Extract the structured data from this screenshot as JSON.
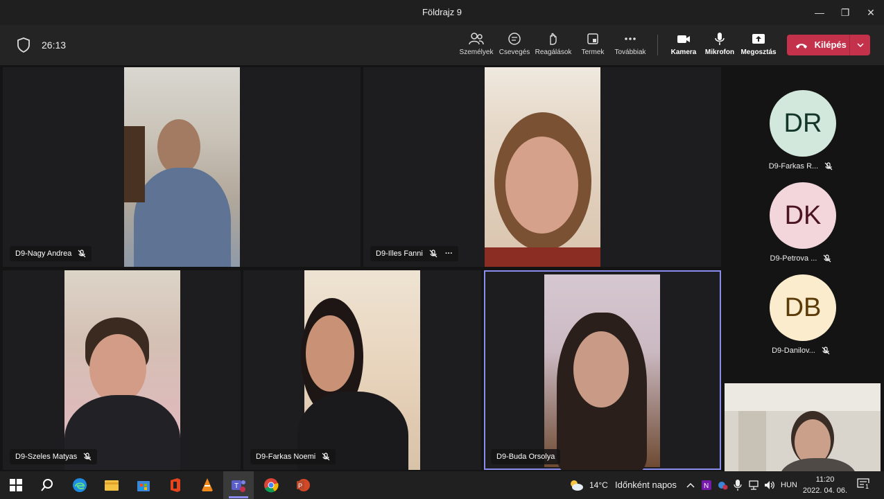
{
  "window": {
    "title": "Földrajz 9",
    "min": "—",
    "max": "❐",
    "close": "✕"
  },
  "toolbar": {
    "timer": "26:13",
    "people": "Személyek",
    "chat": "Csevegés",
    "reactions": "Reagálások",
    "rooms": "Termek",
    "more": "Továbbiak",
    "camera": "Kamera",
    "mic": "Mikrofon",
    "share": "Megosztás",
    "leave": "Kilépés"
  },
  "tiles": [
    {
      "name": "D9-Nagy Andrea"
    },
    {
      "name": "D9-Illes Fanni",
      "more": "···"
    },
    {
      "name": "D9-Szeles Matyas"
    },
    {
      "name": "D9-Farkas Noemi"
    },
    {
      "name": "D9-Buda Orsolya"
    }
  ],
  "side": [
    {
      "initials": "DR",
      "name": "D9-Farkas R...",
      "color": "#d3e8dc",
      "text": "#14352a"
    },
    {
      "initials": "DK",
      "name": "D9-Petrova ...",
      "color": "#f2d6dc",
      "text": "#4a1420"
    },
    {
      "initials": "DB",
      "name": "D9-Danilov...",
      "color": "#fbeccd",
      "text": "#5b3b08"
    }
  ],
  "taskbar": {
    "weather_temp": "14°C",
    "weather_text": "Időnként napos",
    "lang": "HUN",
    "time": "11:20",
    "date": "2022. 04. 06.",
    "notif": "1"
  },
  "colors": {
    "accent": "#8b8cf0",
    "leave": "#c4314b"
  }
}
